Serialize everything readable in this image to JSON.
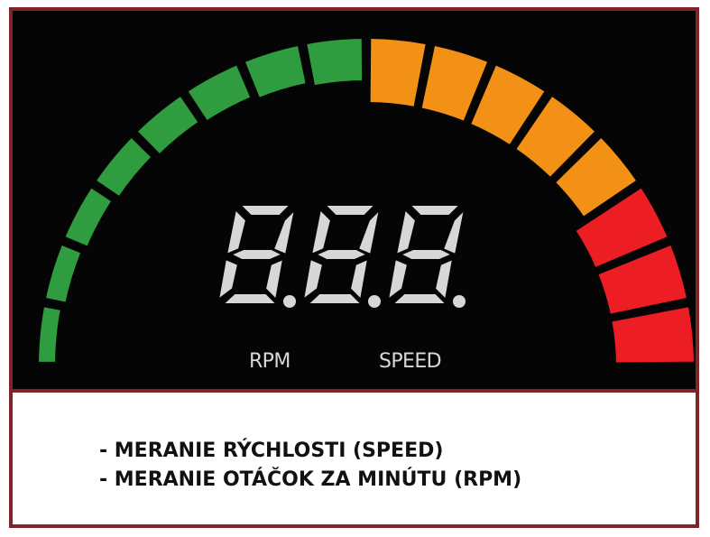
{
  "display": {
    "digits": "8.8.8.",
    "labels": {
      "rpm": "RPM",
      "speed": "SPEED"
    }
  },
  "caption": {
    "line1": "- MERANIE RÝCHLOSTI (SPEED)",
    "line2": "- MERANIE OTÁČOK ZA MINÚTU (RPM)"
  },
  "gauge": {
    "segments": [
      {
        "color": "#2f9c3f"
      },
      {
        "color": "#2f9c3f"
      },
      {
        "color": "#2f9c3f"
      },
      {
        "color": "#2f9c3f"
      },
      {
        "color": "#2f9c3f"
      },
      {
        "color": "#2f9c3f"
      },
      {
        "color": "#2f9c3f"
      },
      {
        "color": "#2f9c3f"
      },
      {
        "color": "#f39116"
      },
      {
        "color": "#f39116"
      },
      {
        "color": "#f39116"
      },
      {
        "color": "#f39116"
      },
      {
        "color": "#f39116"
      },
      {
        "color": "#ec1e24"
      },
      {
        "color": "#ec1e24"
      },
      {
        "color": "#ec1e24"
      }
    ]
  },
  "theme": {
    "frame": "#7d252a",
    "panel": "#050505",
    "digit": "#d7d7d7",
    "label": "#d8d8d8",
    "text": "#111111"
  }
}
